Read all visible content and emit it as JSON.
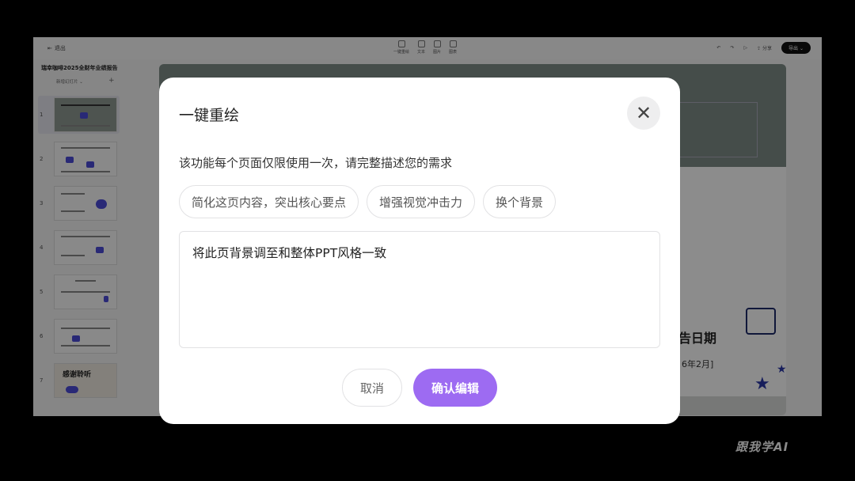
{
  "app": {
    "exit_label": "退出",
    "doc_title": "瑞幸咖啡2025全财年业绩报告",
    "new_slide_label": "新增幻灯片",
    "add_icon": "plus-icon",
    "toolbar": [
      {
        "label": "一键重绘",
        "icon": "magic-wand-icon"
      },
      {
        "label": "文本",
        "icon": "text-icon"
      },
      {
        "label": "图片",
        "icon": "image-icon"
      },
      {
        "label": "图表",
        "icon": "chart-icon"
      }
    ],
    "share_label": "分享",
    "export_label": "导出",
    "slides": [
      "1",
      "2",
      "3",
      "4",
      "5",
      "6",
      "7"
    ],
    "last_slide_title": "感谢聆听",
    "canvas": {
      "date_title": "告日期",
      "date_sub": "6年2月]"
    }
  },
  "modal": {
    "title": "一键重绘",
    "close_icon": "close-icon",
    "description": "该功能每个页面仅限使用一次，请完整描述您的需求",
    "suggestions": [
      "简化这页内容，突出核心要点",
      "增强视觉冲击力",
      "换个背景"
    ],
    "input_value": "将此页背景调至和整体PPT风格一致",
    "cancel_label": "取消",
    "confirm_label": "确认编辑",
    "accent_color": "#9d6bf2"
  },
  "watermark": "跟我学AI"
}
